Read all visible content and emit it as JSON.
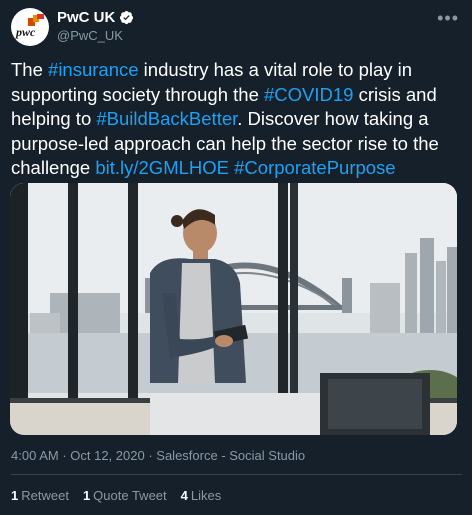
{
  "account": {
    "display_name": "PwC UK",
    "handle": "@PwC_UK",
    "avatar_logo_text": "pwc",
    "verified": true
  },
  "tweet": {
    "segments": [
      {
        "text": "The ",
        "link": false
      },
      {
        "text": "#insurance",
        "link": true
      },
      {
        "text": " industry has a vital role to play in supporting society through the ",
        "link": false
      },
      {
        "text": "#COVID19",
        "link": true
      },
      {
        "text": " crisis and helping to ",
        "link": false
      },
      {
        "text": "#BuildBackBetter",
        "link": true
      },
      {
        "text": ". Discover how taking a purpose-led approach can help the sector rise to the challenge ",
        "link": false
      },
      {
        "text": "bit.ly/2GMLHOE",
        "link": true
      },
      {
        "text": " ",
        "link": false
      },
      {
        "text": "#CorporatePurpose",
        "link": true
      }
    ]
  },
  "media": {
    "alt": "Man holding a tablet looking out of an office window at a city harbour and bridge"
  },
  "meta": {
    "time": "4:00 AM",
    "separator1": " · ",
    "date": "Oct 12, 2020",
    "separator2": " · ",
    "source": "Salesforce - Social Studio"
  },
  "stats": {
    "retweets_count": "1",
    "retweets_label": "Retweet",
    "quotes_count": "1",
    "quotes_label": "Quote Tweet",
    "likes_count": "4",
    "likes_label": "Likes"
  },
  "colors": {
    "background": "#15202b",
    "link": "#1da1f2",
    "secondary_text": "#8899a6",
    "divider": "#38444d",
    "verified_badge": "#ffffff"
  }
}
